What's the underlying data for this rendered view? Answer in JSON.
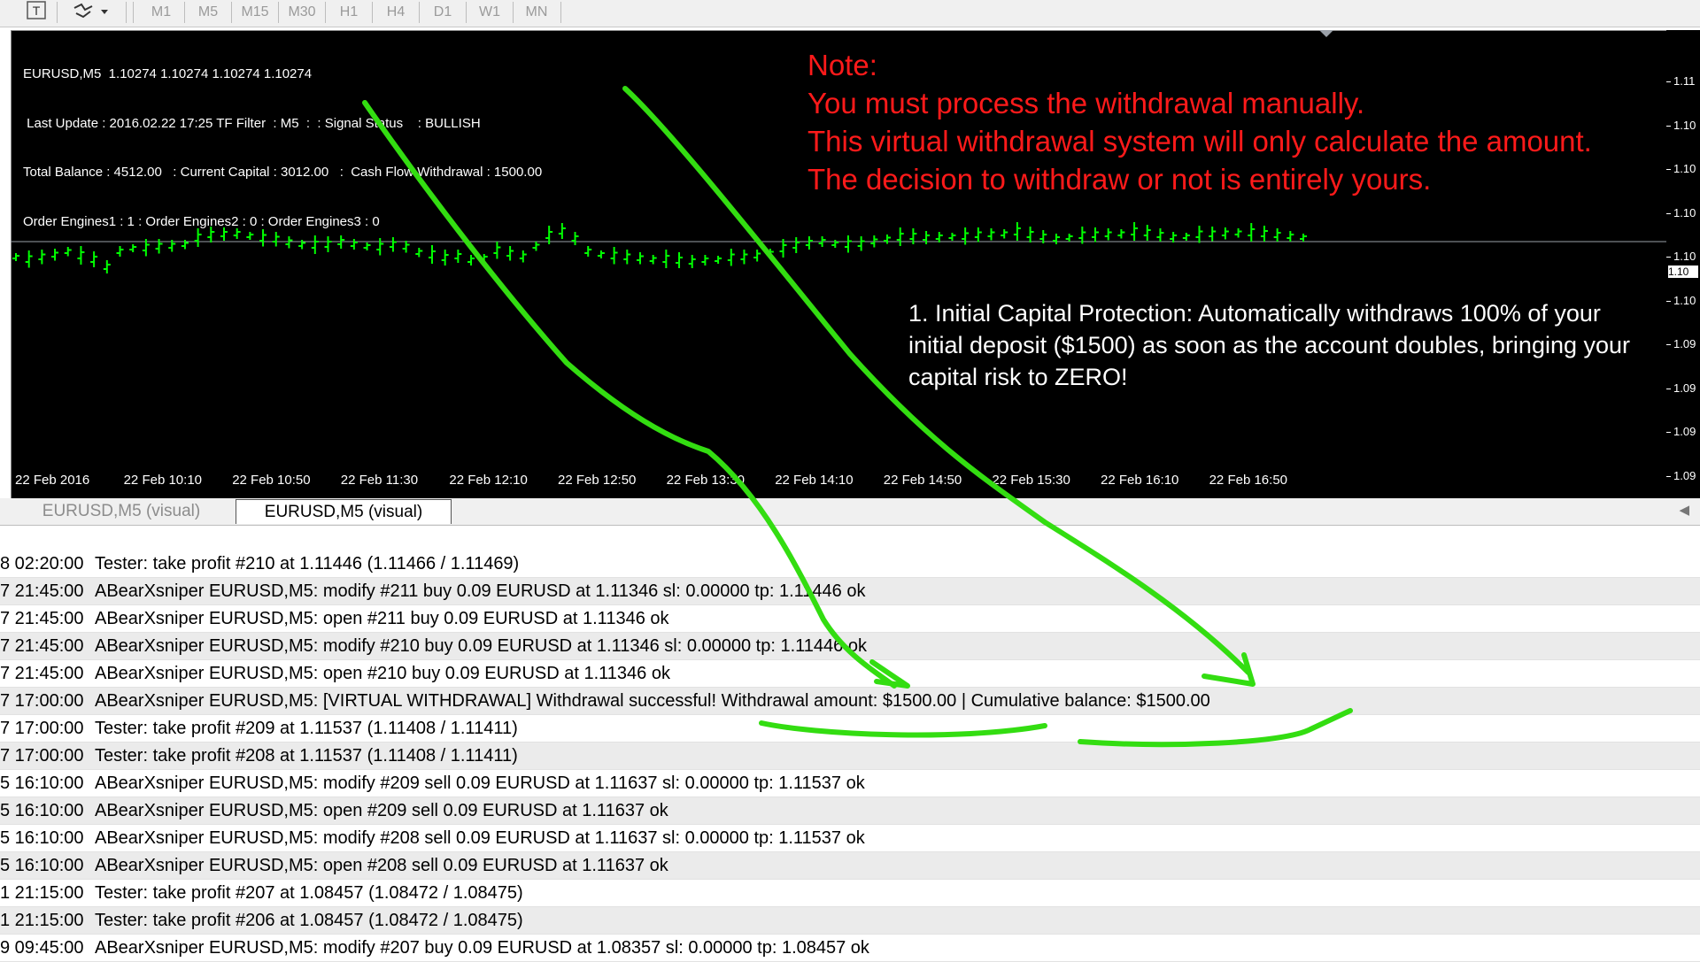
{
  "toolbar": {
    "timeframes": [
      "M1",
      "M5",
      "M15",
      "M30",
      "H1",
      "H4",
      "D1",
      "W1",
      "MN"
    ]
  },
  "chart": {
    "info_lines": [
      "EURUSD,M5  1.10274 1.10274 1.10274 1.10274",
      " Last Update : 2016.02.22 17:25 TF Filter  : M5  :  : Signal Status    : BULLISH",
      "Total Balance : 4512.00   : Current Capital : 3012.00   :  Cash Flow Withdrawal : 1500.00",
      "Order Engines1 : 1 : Order Engines2 : 0 : Order Engines3 : 0"
    ],
    "note_lines": [
      "Note:",
      "You must process the withdrawal manually.",
      "This virtual withdrawal system will only calculate the amount.",
      "The decision to withdraw or not is entirely yours."
    ],
    "feature_text": "1. Initial Capital Protection: Automatically withdraws 100% of your initial deposit ($1500) as soon as the account doubles, bringing your capital risk to ZERO!",
    "price_labels": [
      "1.11",
      "1.10",
      "1.10",
      "1.10",
      "1.10",
      "1.10",
      "1.09",
      "1.09",
      "1.09",
      "1.09"
    ],
    "current_price_label": "1.10",
    "time_labels": [
      "22 Feb 2016",
      "22 Feb 10:10",
      "22 Feb 10:50",
      "22 Feb 11:30",
      "22 Feb 12:10",
      "22 Feb 12:50",
      "22 Feb 13:30",
      "22 Feb 14:10",
      "22 Feb 14:50",
      "22 Feb 15:30",
      "22 Feb 16:10",
      "22 Feb 16:50"
    ],
    "bar_color": "#00ff00",
    "background": "#000000",
    "annotation_color": "#33dd11"
  },
  "tabs": [
    "EURUSD,M5 (visual)",
    "EURUSD,M5 (visual)"
  ],
  "log": [
    {
      "time": "8 02:20:00",
      "msg": "Tester: take profit #210 at 1.11446 (1.11466 / 1.11469)"
    },
    {
      "time": "7 21:45:00",
      "msg": "ABearXsniper EURUSD,M5: modify #211 buy 0.09 EURUSD at 1.11346 sl: 0.00000 tp: 1.11446 ok"
    },
    {
      "time": "7 21:45:00",
      "msg": "ABearXsniper EURUSD,M5: open #211 buy 0.09 EURUSD at 1.11346 ok"
    },
    {
      "time": "7 21:45:00",
      "msg": "ABearXsniper EURUSD,M5: modify #210 buy 0.09 EURUSD at 1.11346 sl: 0.00000 tp: 1.11446 ok"
    },
    {
      "time": "7 21:45:00",
      "msg": "ABearXsniper EURUSD,M5: open #210 buy 0.09 EURUSD at 1.11346 ok"
    },
    {
      "time": "7 17:00:00",
      "msg": "ABearXsniper EURUSD,M5: [VIRTUAL WITHDRAWAL] Withdrawal successful! Withdrawal amount: $1500.00 | Cumulative balance: $1500.00"
    },
    {
      "time": "7 17:00:00",
      "msg": "Tester: take profit #209 at 1.11537 (1.11408 / 1.11411)"
    },
    {
      "time": "7 17:00:00",
      "msg": "Tester: take profit #208 at 1.11537 (1.11408 / 1.11411)"
    },
    {
      "time": "5 16:10:00",
      "msg": "ABearXsniper EURUSD,M5: modify #209 sell 0.09 EURUSD at 1.11637 sl: 0.00000 tp: 1.11537 ok"
    },
    {
      "time": "5 16:10:00",
      "msg": "ABearXsniper EURUSD,M5: open #209 sell 0.09 EURUSD at 1.11637 ok"
    },
    {
      "time": "5 16:10:00",
      "msg": "ABearXsniper EURUSD,M5: modify #208 sell 0.09 EURUSD at 1.11637 sl: 0.00000 tp: 1.11537 ok"
    },
    {
      "time": "5 16:10:00",
      "msg": "ABearXsniper EURUSD,M5: open #208 sell 0.09 EURUSD at 1.11637 ok"
    },
    {
      "time": "1 21:15:00",
      "msg": "Tester: take profit #207 at 1.08457 (1.08472 / 1.08475)"
    },
    {
      "time": "1 21:15:00",
      "msg": "Tester: take profit #206 at 1.08457 (1.08472 / 1.08475)"
    },
    {
      "time": "9 09:45:00",
      "msg": "ABearXsniper EURUSD,M5: modify #207 buy 0.09 EURUSD at 1.08357 sl: 0.00000 tp: 1.08457 ok"
    }
  ]
}
